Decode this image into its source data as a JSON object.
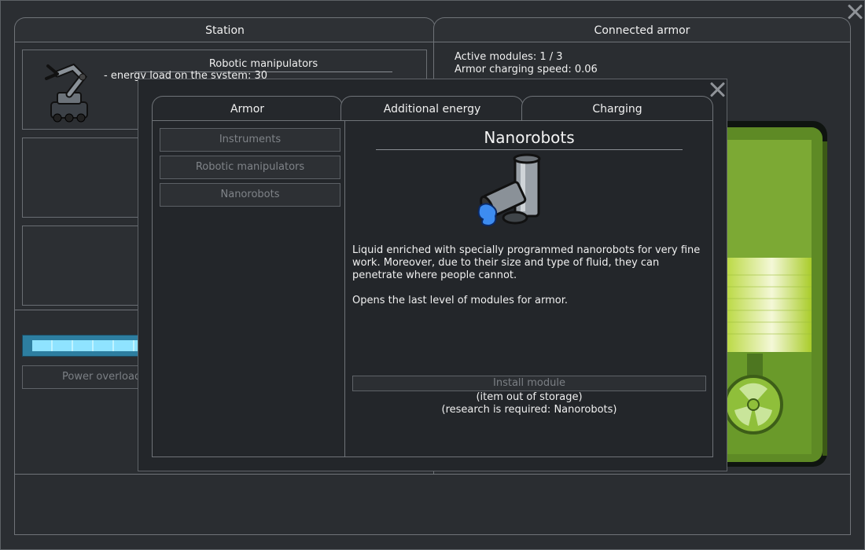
{
  "station": {
    "tab_label": "Station",
    "slot1_title": "Robotic manipulators",
    "slot1_text": "- energy load on the system: 30",
    "power_button": "Power overload"
  },
  "armor_panel": {
    "tab_label": "Connected armor",
    "active_modules": "Active modules: 1 / 3",
    "charging_speed": "Armor charging speed: 0.06"
  },
  "dialog": {
    "tabs": [
      "Armor",
      "Additional energy",
      "Charging"
    ],
    "list_items": [
      "Instruments",
      "Robotic manipulators",
      "Nanorobots"
    ],
    "detail": {
      "title": "Nanorobots",
      "description": "Liquid enriched with specially programmed nanorobots for very fine work. Moreover, due to their size and type of fluid, they can penetrate where people cannot.",
      "note": "Opens the last level of modules for armor.",
      "install_button": "Install module",
      "status1": "(item out of storage)",
      "status2": "(research is required: Nanorobots)"
    }
  },
  "colors": {
    "accent_green": "#7fb33a",
    "energy_blue": "#6fd0f0"
  }
}
